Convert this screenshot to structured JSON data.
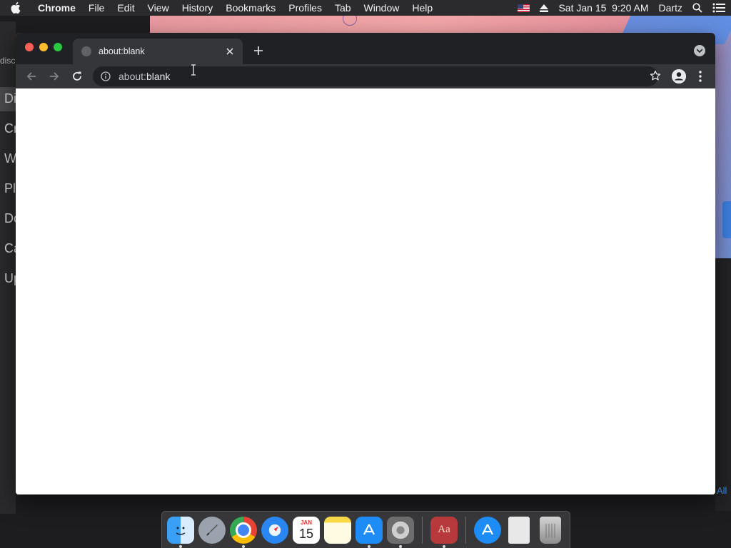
{
  "menubar": {
    "app_name": "Chrome",
    "items": [
      "File",
      "Edit",
      "View",
      "History",
      "Bookmarks",
      "Profiles",
      "Tab",
      "Window",
      "Help"
    ],
    "datetime": "Sat Jan 15  9:20 AM",
    "user": "Dartz",
    "icons": [
      "apple-icon",
      "flag-icon",
      "eject-icon",
      "spotlight-icon",
      "control-center-icon"
    ]
  },
  "background_window": {
    "header_fragment": "disco",
    "items": [
      "Di",
      "Cr",
      "W",
      "Pl",
      "Do",
      "Ca",
      "Up"
    ],
    "footer_link": "All"
  },
  "chrome": {
    "tab": {
      "title": "about:blank",
      "favicon": "globe-icon"
    },
    "omnibox": {
      "scheme": "about:",
      "host": "blank",
      "icon": "info-icon"
    },
    "toolbar_icons": [
      "back-icon",
      "forward-icon",
      "reload-icon",
      "star-icon",
      "profile-icon",
      "menu-icon"
    ]
  },
  "dock": {
    "apps": [
      {
        "name": "Finder",
        "running": true
      },
      {
        "name": "Launchpad",
        "running": false
      },
      {
        "name": "Google Chrome",
        "running": true
      },
      {
        "name": "Safari",
        "running": false
      },
      {
        "name": "Calendar",
        "running": false,
        "month": "JAN",
        "day": "15"
      },
      {
        "name": "Notes",
        "running": false
      },
      {
        "name": "App Store",
        "running": true
      },
      {
        "name": "System Preferences",
        "running": true
      },
      {
        "name": "Dictionary",
        "running": true,
        "label": "Aa"
      },
      {
        "name": "App Store",
        "running": false
      },
      {
        "name": "Document",
        "running": false
      },
      {
        "name": "Trash",
        "running": false
      }
    ]
  },
  "colors": {
    "menubar": "#2b2b2d",
    "chrome_tabstrip": "#202124",
    "chrome_toolbar": "#35363a",
    "page_background": "#ffffff"
  }
}
